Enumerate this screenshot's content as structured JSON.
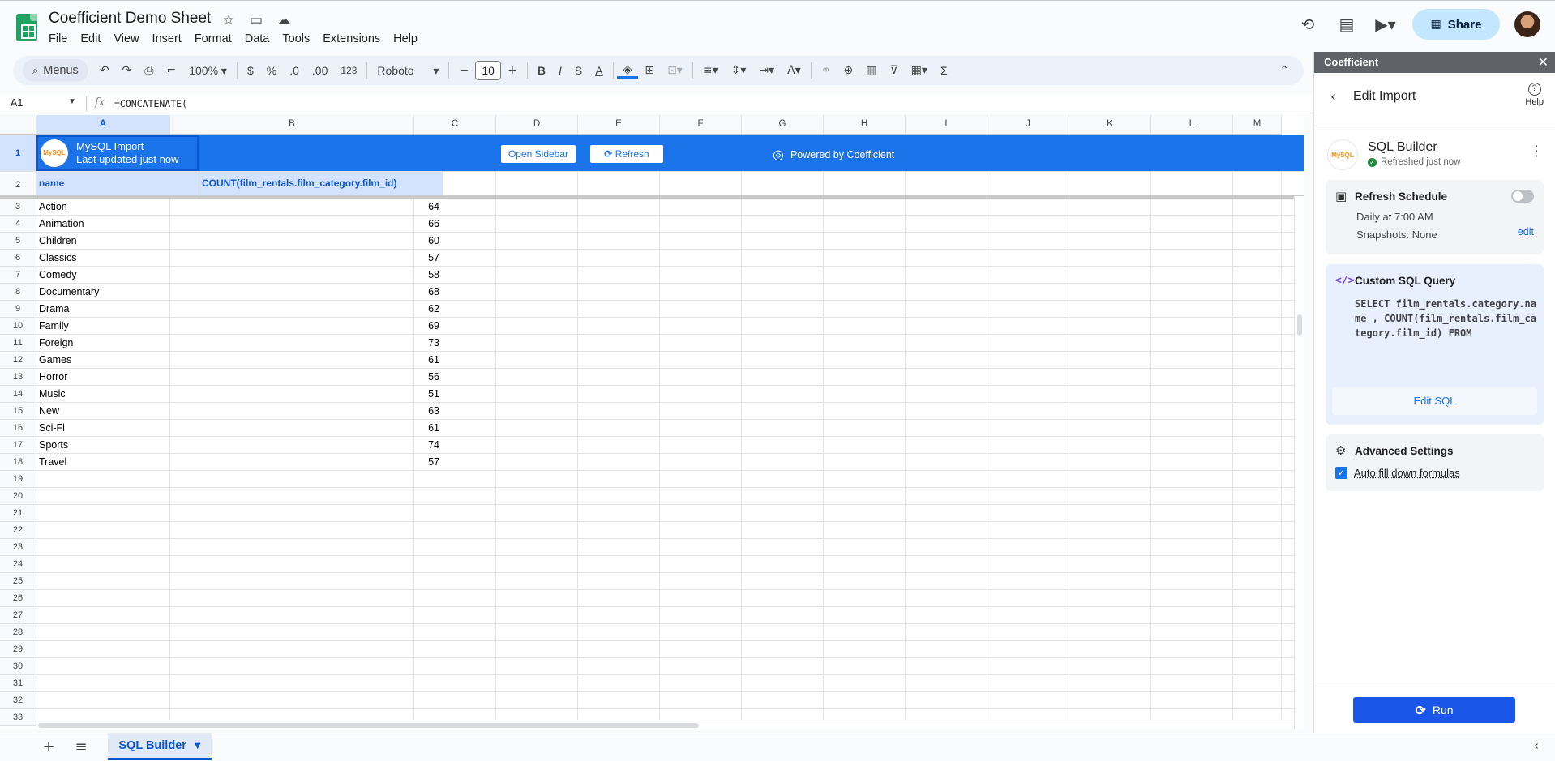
{
  "doc": {
    "title": "Coefficient Demo Sheet",
    "menu": [
      "File",
      "Edit",
      "View",
      "Insert",
      "Format",
      "Data",
      "Tools",
      "Extensions",
      "Help"
    ],
    "share_label": "Share"
  },
  "toolbar": {
    "menus_label": "Menus",
    "zoom": "100%",
    "currency": "$",
    "percent": "%",
    "dec_decrease": ".0",
    "dec_increase": ".00",
    "number_format": "123",
    "font": "Roboto",
    "font_size": "10",
    "bold": "B",
    "italic": "I",
    "strike": "S",
    "text_color": "A",
    "sum": "Σ"
  },
  "formula_bar": {
    "cell_ref": "A1",
    "fx": "fx",
    "formula": "=CONCATENATE("
  },
  "grid": {
    "columns": [
      "A",
      "B",
      "C",
      "D",
      "E",
      "F",
      "G",
      "H",
      "I",
      "J",
      "K",
      "L",
      "M"
    ],
    "rows": [
      "1",
      "2",
      "3",
      "4",
      "5",
      "6",
      "7",
      "8",
      "9",
      "10",
      "11",
      "12",
      "13",
      "14",
      "15",
      "16",
      "17",
      "18",
      "19",
      "20",
      "21",
      "22",
      "23",
      "24",
      "25",
      "26",
      "27",
      "28",
      "29",
      "30",
      "31",
      "32",
      "33"
    ],
    "banner": {
      "source_logo": "MySQL",
      "title": "MySQL Import",
      "subtitle": "Last updated just now",
      "open_sidebar": "Open Sidebar",
      "refresh": "Refresh",
      "powered_by": "Powered by Coefficient"
    },
    "headers": [
      "name",
      "COUNT(film_rentals.film_category.film_id)"
    ],
    "data": [
      [
        "Action",
        "64"
      ],
      [
        "Animation",
        "66"
      ],
      [
        "Children",
        "60"
      ],
      [
        "Classics",
        "57"
      ],
      [
        "Comedy",
        "58"
      ],
      [
        "Documentary",
        "68"
      ],
      [
        "Drama",
        "62"
      ],
      [
        "Family",
        "69"
      ],
      [
        "Foreign",
        "73"
      ],
      [
        "Games",
        "61"
      ],
      [
        "Horror",
        "56"
      ],
      [
        "Music",
        "51"
      ],
      [
        "New",
        "63"
      ],
      [
        "Sci-Fi",
        "61"
      ],
      [
        "Sports",
        "74"
      ],
      [
        "Travel",
        "57"
      ]
    ]
  },
  "sheet_tab": "SQL Builder",
  "sidebar": {
    "header": "Coefficient",
    "title": "Edit Import",
    "help": "Help",
    "source_logo": "MySQL",
    "source_name": "SQL Builder",
    "source_status": "Refreshed just now",
    "schedule": {
      "title": "Refresh Schedule",
      "line1": "Daily at 7:00 AM",
      "line2": "Snapshots: None",
      "edit": "edit"
    },
    "query": {
      "title": "Custom SQL Query",
      "sql": "SELECT film_rentals.category.name , COUNT(film_rentals.film_category.film_id) FROM",
      "edit_label": "Edit SQL"
    },
    "advanced": {
      "title": "Advanced Settings",
      "option": "Auto fill down formulas"
    },
    "run_label": "Run"
  }
}
